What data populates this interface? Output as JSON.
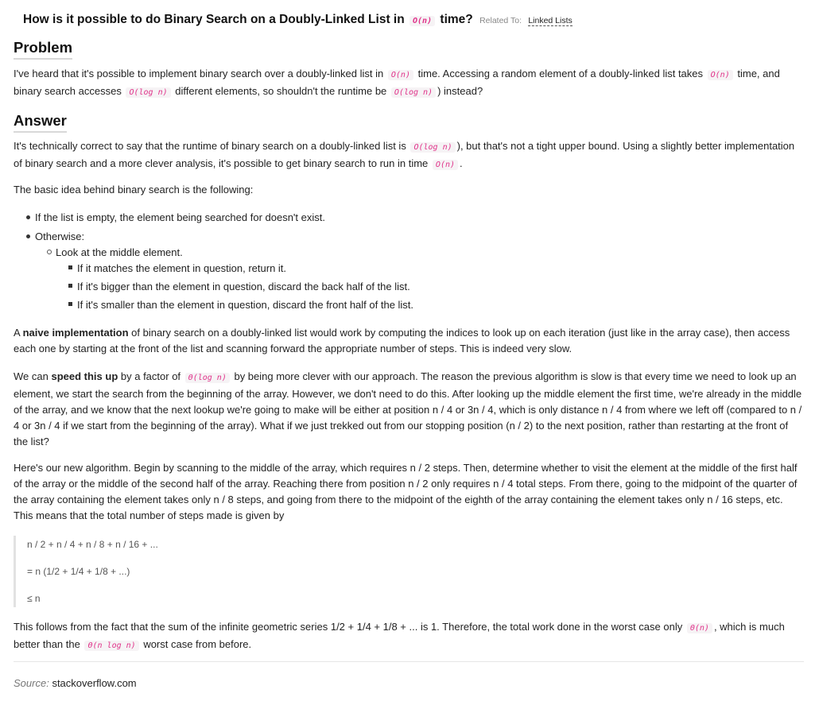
{
  "title": {
    "prefix": "How is it possible to do Binary Search on a Doubly-Linked List in",
    "code": "O(n)",
    "suffix": "time?",
    "related_label": "Related To:",
    "related_link": "Linked Lists"
  },
  "problem": {
    "heading": "Problem",
    "t1": "I've heard that it's possible to implement binary search over a doubly-linked list in",
    "c1": "O(n)",
    "t2": "time. Accessing a random element of a doubly-linked list takes",
    "c2": "O(n)",
    "t3": "time, and binary search accesses",
    "c3": "O(log n)",
    "t4": "different elements, so shouldn't the runtime be",
    "c4": "O(log n)",
    "t5": ") instead?"
  },
  "answer": {
    "heading": "Answer",
    "p1": {
      "t1": "It's technically correct to say that the runtime of binary search on a doubly-linked list is",
      "c1": "O(log n)",
      "t2": "), but that's not a tight upper bound. Using a slightly better implementation of binary search and a more clever analysis, it's possible to get binary search to run in time",
      "c2": "O(n)",
      "t3": "."
    },
    "p2": "The basic idea behind binary search is the following:",
    "list": {
      "l1": "If the list is empty, the element being searched for doesn't exist.",
      "l2": "Otherwise:",
      "l3": "Look at the middle element.",
      "l4": "If it matches the element in question, return it.",
      "l5": "If it's bigger than the element in question, discard the back half of the list.",
      "l6": "If it's smaller than the element in question, discard the front half of the list."
    },
    "p3": {
      "t1": "A",
      "bold": "naive implementation",
      "t2": "of binary search on a doubly-linked list would work by computing the indices to look up on each iteration (just like in the array case), then access each one by starting at the front of the list and scanning forward the appropriate number of steps. This is indeed very slow."
    },
    "p4": {
      "t1": "We can",
      "bold": "speed this up",
      "t2": "by a factor of",
      "c1": "Θ(log n)",
      "t3": "by being more clever with our approach. The reason the previous algorithm is slow is that every time we need to look up an element, we start the search from the beginning of the array. However, we don't need to do this. After looking up the middle element the first time, we're already in the middle of the array, and we know that the next lookup we're going to make will be either at position n / 4 or 3n / 4, which is only distance n / 4 from where we left off (compared to n / 4 or 3n / 4 if we start from the beginning of the array). What if we just trekked out from our stopping position (n / 2) to the next position, rather than restarting at the front of the list?"
    },
    "p5": "Here's our new algorithm. Begin by scanning to the middle of the array, which requires n / 2 steps. Then, determine whether to visit the element at the middle of the first half of the array or the middle of the second half of the array. Reaching there from position n / 2 only requires n / 4 total steps. From there, going to the midpoint of the quarter of the array containing the element takes only n / 8 steps, and going from there to the midpoint of the eighth of the array containing the element takes only n / 16 steps, etc. This means that the total number of steps made is given by",
    "eq1": "n / 2 + n / 4 + n / 8 + n / 16 + ...",
    "eq2": "= n (1/2 + 1/4 + 1/8 + ...)",
    "eq3": "≤ n",
    "p6": {
      "t1": "This follows from the fact that the sum of the infinite geometric series 1/2 + 1/4 + 1/8 + ... is 1. Therefore, the total work done in the worst case only",
      "c1": "Θ(n)",
      "t2": ", which is much better than the",
      "c2": "Θ(n log n)",
      "t3": "worst case from before."
    }
  },
  "source": {
    "label": "Source:",
    "value": "stackoverflow.com"
  }
}
